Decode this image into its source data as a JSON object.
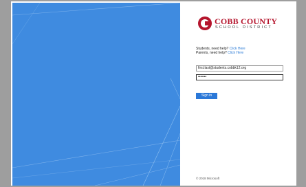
{
  "logo": {
    "title": "COBB COUNTY",
    "subtitle": "SCHOOL DISTRICT"
  },
  "help": {
    "students_text": "Students, need help?",
    "students_link": "Click Here",
    "parents_text": "Parents, need help?",
    "parents_link": "Click Here"
  },
  "form": {
    "username_value": "first.last@students.cobbk12.org",
    "password_value": "•••••••",
    "signin_label": "Sign in"
  },
  "footer": {
    "copyright": "© 2018 Microsoft"
  },
  "colors": {
    "brand_red": "#b5152d",
    "background_blue": "#3f8be0",
    "button_blue": "#2b78d8",
    "link_blue": "#2b7bd6"
  }
}
